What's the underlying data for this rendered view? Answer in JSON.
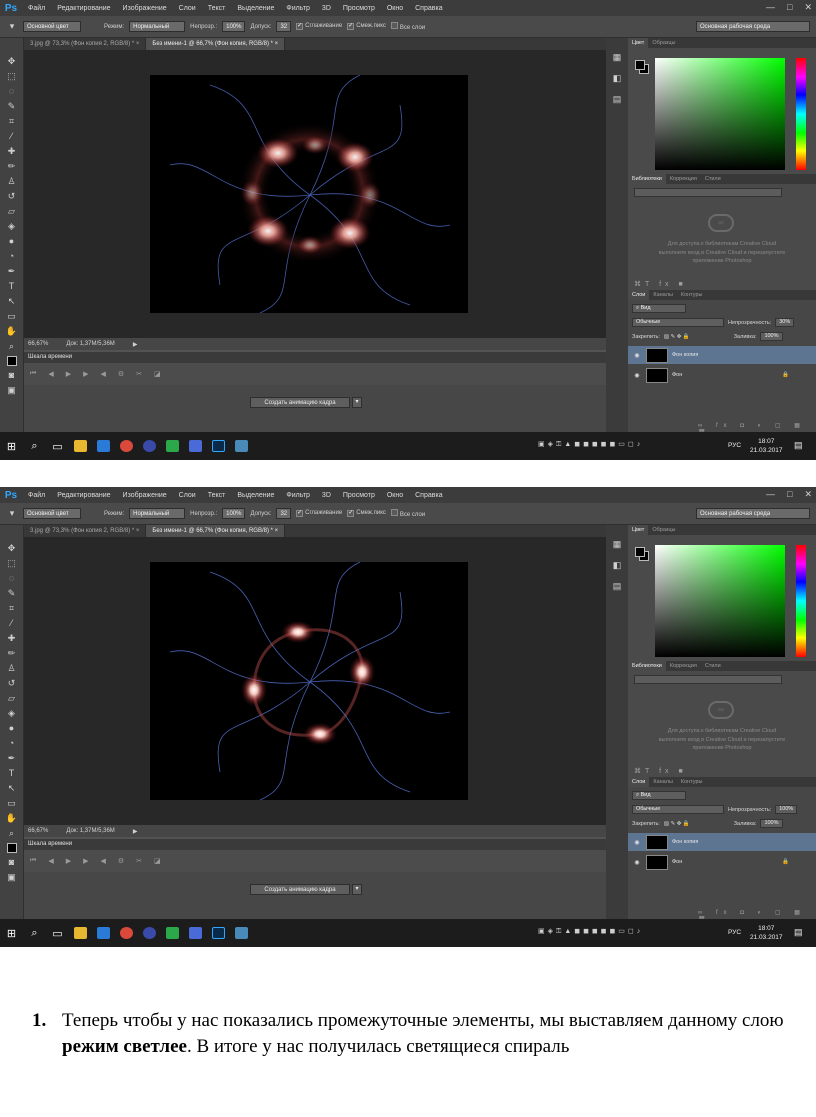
{
  "app": {
    "logo": "Ps",
    "menu": [
      "Файл",
      "Редактирование",
      "Изображение",
      "Слои",
      "Текст",
      "Выделение",
      "Фильтр",
      "3D",
      "Просмотр",
      "Окно",
      "Справка"
    ],
    "window_buttons": [
      "—",
      "□",
      "✕"
    ]
  },
  "options_bar": {
    "brush_preset": "Основной цвет",
    "mode_label": "Режим:",
    "mode_value": "Нормальный",
    "opacity_label": "Непрозр.:",
    "opacity_value": "100%",
    "tolerance_label": "Допуск:",
    "tolerance_value": "32",
    "antialias": "Сглаживание",
    "contiguous": "Смеж.пикс",
    "all_layers": "Все слои",
    "workspace": "Основная рабочая среда"
  },
  "documents": {
    "tab1": "3.jpg @ 73,3% (Фон копия 2, RGB/8) *",
    "tab2_shot1": "Без имени-1 @ 66,7% (Фон копия, RGB/8) *",
    "tab2_shot2": "Без имени-1 @ 66,7% (Фон копия, RGB/8) *",
    "close": "×"
  },
  "status": {
    "zoom": "66,67%",
    "doc": "Док: 1,37М/5,36М"
  },
  "timeline": {
    "title": "Шкала времени",
    "create_button": "Создать анимацию кадра"
  },
  "panels": {
    "color_tabs": [
      "Цвет",
      "Образцы"
    ],
    "library_tabs": [
      "Библиотеки",
      "Коррекция",
      "Стили"
    ],
    "library_message": "Для доступа к библиотекам Creative Cloud выполните вход в Creative Cloud и перезапустите приложение Photoshop",
    "layers_tabs": [
      "Слои",
      "Каналы",
      "Контуры"
    ],
    "layer_filter": "Вид",
    "blend_shot1": "Обычные",
    "blend_shot2": "Обычные",
    "opacity_label": "Непрозрачность:",
    "opacity_shot1": "30%",
    "opacity_shot2": "100%",
    "lock_label": "Закрепить:",
    "fill_label": "Заливка:",
    "fill_value": "100%",
    "layers": [
      {
        "name": "Фон копия"
      },
      {
        "name": "Фон"
      }
    ]
  },
  "taskbar": {
    "lang": "РУС",
    "time": "18:07",
    "date": "21.03.2017"
  },
  "caption": {
    "number": "1.",
    "text_before": "Теперь чтобы у нас показались промежуточные элементы, мы выставляем данному слою ",
    "bold": "режим светлее",
    "text_after": ". В итоге у нас получилась светящиеся спираль"
  },
  "colors": {
    "ps_dark": "#535353",
    "ps_blue": "#31a8ff",
    "layer_selected": "#5e7591",
    "glow": "#ff9a8a",
    "swirl": "#5a7adf"
  }
}
